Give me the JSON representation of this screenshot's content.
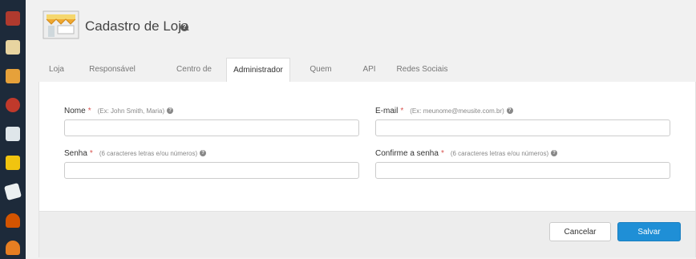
{
  "rail": {
    "icons": [
      "box-icon",
      "store-icon",
      "package-icon",
      "discount-icon",
      "card-icon",
      "truck-icon",
      "note-icon",
      "users-icon",
      "person-icon"
    ],
    "colors": [
      "#c0392b",
      "#e8b94a",
      "#e67e22",
      "#c0392b",
      "#ecf0f1",
      "#f1c40f",
      "#ecf0f1",
      "#e74c3c",
      "#e67e22"
    ]
  },
  "header": {
    "title": "Cadastro de Loja",
    "help": "?"
  },
  "tabs": [
    {
      "label": "Loja"
    },
    {
      "label": "Responsável"
    },
    {
      "label": "Centro de Distribuição"
    },
    {
      "label": "Administrador"
    },
    {
      "label": "Quem Somos"
    },
    {
      "label": "API"
    },
    {
      "label": "Redes Sociais"
    }
  ],
  "active_tab": "Administrador",
  "form": {
    "nome": {
      "label": "Nome",
      "req": "*",
      "hint": "(Ex: John Smith, Maria)",
      "value": ""
    },
    "email": {
      "label": "E-mail",
      "req": "*",
      "hint": "(Ex: meunome@meusite.com.br)",
      "value": ""
    },
    "senha": {
      "label": "Senha",
      "req": "*",
      "hint": "(6 caracteres letras e/ou números)",
      "value": ""
    },
    "confirme": {
      "label": "Confirme a senha",
      "req": "*",
      "hint": "(6 caracteres letras e/ou números)",
      "value": ""
    }
  },
  "buttons": {
    "cancel": "Cancelar",
    "save": "Salvar"
  }
}
